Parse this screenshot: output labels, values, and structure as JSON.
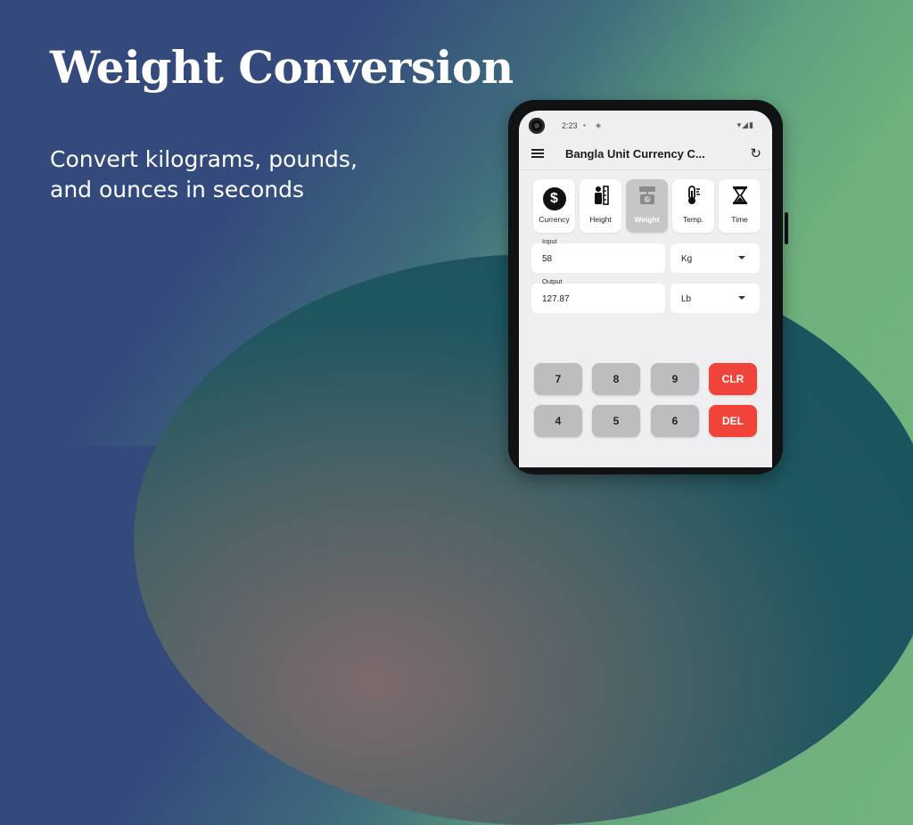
{
  "promo": {
    "headline": "Weight Conversion",
    "subline_1": "Convert kilograms, pounds,",
    "subline_2": "and ounces in seconds"
  },
  "status_bar": {
    "time": "2:23"
  },
  "app_bar": {
    "title": "Bangla Unit Currency C..."
  },
  "categories": [
    {
      "label": "Currency",
      "icon": "dollar-circle-icon"
    },
    {
      "label": "Height",
      "icon": "person-ruler-icon"
    },
    {
      "label": "Weight",
      "icon": "scale-icon"
    },
    {
      "label": "Temp.",
      "icon": "thermometer-icon"
    },
    {
      "label": "Time",
      "icon": "hourglass-icon"
    }
  ],
  "selected_category": "Weight",
  "converter": {
    "input_label": "Input",
    "input_value": "58",
    "input_unit": "Kg",
    "output_label": "Output",
    "output_value": "127.87",
    "output_unit": "Lb"
  },
  "keypad": {
    "row1": [
      "7",
      "8",
      "9",
      "CLR"
    ],
    "row2": [
      "4",
      "5",
      "6",
      "DEL"
    ]
  },
  "colors": {
    "accent_red": "#f0443a",
    "selected_tab": "#c6c6c8",
    "key_gray": "#bdbdbf"
  }
}
